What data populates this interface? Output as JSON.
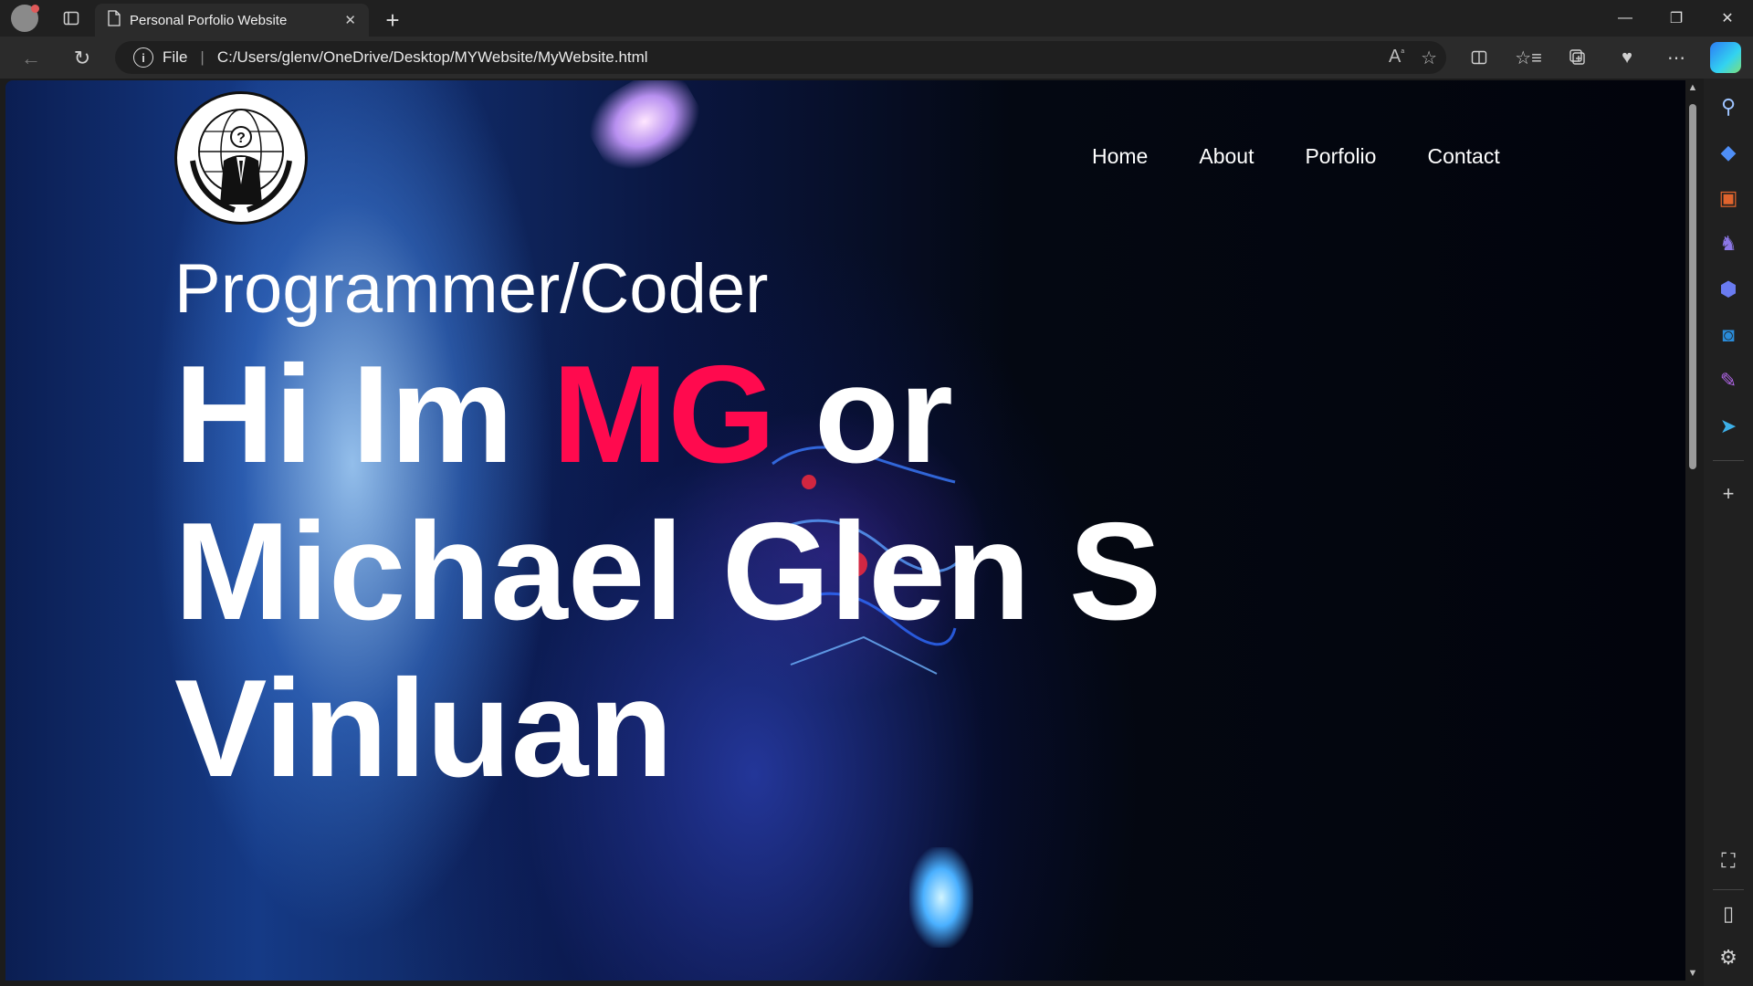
{
  "tab": {
    "title": "Personal Porfolio Website",
    "close": "✕",
    "new": "+"
  },
  "window_controls": {
    "minimize": "—",
    "restore": "❐",
    "close": "✕"
  },
  "address": {
    "scheme": "File",
    "separator": "|",
    "url": "C:/Users/glenv/OneDrive/Desktop/MYWebsite/MyWebsite.html"
  },
  "site": {
    "nav": [
      "Home",
      "About",
      "Porfolio",
      "Contact"
    ],
    "subtitle": "Programmer/Coder",
    "hero_prefix": "Hi Im ",
    "hero_highlight": "MG",
    "hero_suffix": " or Michael Glen S Vinluan",
    "accent_color": "#ff0a4e"
  },
  "icons": {
    "toolbar": [
      "back-icon",
      "refresh-icon",
      "info-icon",
      "read-aloud-icon",
      "favorite-star-icon",
      "split-screen-icon",
      "favorites-icon",
      "collections-icon",
      "browser-essentials-icon",
      "more-icon",
      "copilot-icon"
    ],
    "sidebar": [
      "search-icon",
      "shopping-icon",
      "tools-icon",
      "games-icon",
      "microsoft-365-icon",
      "outlook-icon",
      "designer-icon",
      "telegram-icon",
      "add-icon",
      "screenshot-icon",
      "sidebar-toggle-icon",
      "settings-icon"
    ]
  }
}
